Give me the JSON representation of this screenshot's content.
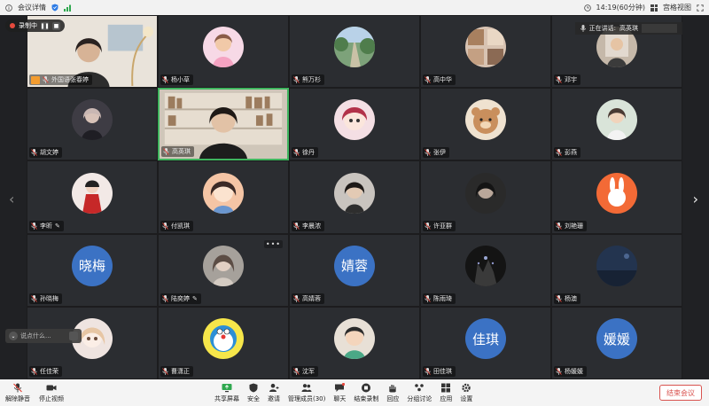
{
  "topbar": {
    "meeting_details": "会议详情",
    "time": "14:19(60分钟)",
    "view": "宫格视图"
  },
  "recording": {
    "label": "录制中"
  },
  "speaking": {
    "label": "正在讲话:",
    "name": "高英琪"
  },
  "chat": {
    "placeholder": "说点什么..."
  },
  "tiles": [
    {
      "name": "外国语张春婷",
      "type": "video-room",
      "host": true
    },
    {
      "name": "杨小草",
      "type": "avatar",
      "av": "pink"
    },
    {
      "name": "熊万杉",
      "type": "avatar",
      "av": "road"
    },
    {
      "name": "高中华",
      "type": "avatar",
      "av": "collage"
    },
    {
      "name": "邓宇",
      "type": "avatar",
      "av": "street"
    },
    {
      "name": "胡文婷",
      "type": "avatar",
      "av": "dark"
    },
    {
      "name": "高英琪",
      "type": "video-shelf",
      "active": true
    },
    {
      "name": "徐丹",
      "type": "avatar",
      "av": "anime"
    },
    {
      "name": "张伊",
      "type": "avatar",
      "av": "bear"
    },
    {
      "name": "彭燕",
      "type": "avatar",
      "av": "girl"
    },
    {
      "name": "李昕",
      "type": "avatar",
      "av": "red",
      "pen": true
    },
    {
      "name": "付凯琪",
      "type": "avatar",
      "av": "cartoon"
    },
    {
      "name": "李晨浓",
      "type": "avatar",
      "av": "dark2"
    },
    {
      "name": "许亚群",
      "type": "avatar",
      "av": "dark3"
    },
    {
      "name": "刘艳珊",
      "type": "avatar",
      "av": "rabbit"
    },
    {
      "name": "孙晓梅",
      "type": "text",
      "text": "晓梅"
    },
    {
      "name": "陆奕婷",
      "type": "avatar",
      "av": "portrait",
      "pen": true,
      "more": true
    },
    {
      "name": "高婧蓉",
      "type": "text",
      "text": "婧蓉"
    },
    {
      "name": "陈雨琦",
      "type": "avatar",
      "av": "night"
    },
    {
      "name": "杨澳",
      "type": "avatar",
      "av": "sky"
    },
    {
      "name": "任佳荣",
      "type": "avatar",
      "av": "animegirl"
    },
    {
      "name": "曹潇正",
      "type": "avatar",
      "av": "doraemon"
    },
    {
      "name": "沈军",
      "type": "avatar",
      "av": "boy"
    },
    {
      "name": "田佳琪",
      "type": "text",
      "text": "佳琪"
    },
    {
      "name": "杨媛媛",
      "type": "text",
      "text": "媛媛"
    }
  ],
  "toolbar": {
    "unmute": "解除静音",
    "stop_video": "停止视频",
    "share": "共享屏幕",
    "security": "安全",
    "invite": "邀请",
    "members": "管理成员(30)",
    "chat": "聊天",
    "end_record": "结束录制",
    "reaction": "回应",
    "breakout": "分组讨论",
    "apps": "应用",
    "settings": "设置",
    "end_meeting": "结束会议"
  },
  "colors": {
    "accent_green": "#3fb55f",
    "text_avatar": "#3b72c4",
    "end_red": "#d9534f",
    "record_red": "#e64a3d"
  }
}
